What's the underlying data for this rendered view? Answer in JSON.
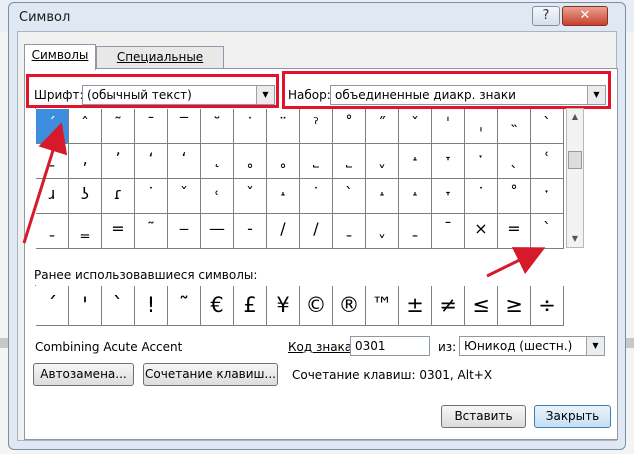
{
  "window": {
    "title": "Символ",
    "help_label": "?",
    "close_label": "✕"
  },
  "tabs": [
    {
      "label": "Символы"
    },
    {
      "label": "Специальные знаки"
    }
  ],
  "font": {
    "label": "Шрифт:",
    "value": "(обычный текст)"
  },
  "subset": {
    "label": "Набор:",
    "value": "объединенные диакр. знаки"
  },
  "symbol_grid": {
    "rows": [
      [
        "ˊ",
        "ˆ",
        "˜",
        "¯",
        "‾",
        "˘",
        "˙",
        "¨",
        "ˀ",
        "˚",
        "˝",
        "ˇ",
        "ˈ",
        "ˌ",
        "˵",
        "ˋ"
      ],
      [
        "ˍ",
        "‚",
        "ʼ",
        "‘",
        "ʻ",
        "˛",
        "˳",
        "˳",
        "˾",
        "˾",
        "ˬ",
        "˔",
        "˕",
        "ˑ",
        "ˎ",
        "ʿ"
      ],
      [
        "ɹ",
        "ʖ",
        "ɾ",
        "˙",
        "ˇ",
        "˓",
        "ˇ",
        "˔",
        "˙",
        "ˋ",
        "˔",
        "˔",
        "˕",
        "˙",
        "˚",
        "ˑ"
      ],
      [
        "ˍ",
        "‗",
        "=",
        "˜",
        "‒",
        "—",
        "‐",
        "/",
        "/",
        "ˍ",
        "ˬ",
        "ˍ",
        "ˉ",
        "×",
        "=",
        "ˋ"
      ]
    ]
  },
  "recent": {
    "label": "Ранее использовавшиеся символы:",
    "symbols": [
      "´",
      "'",
      "`",
      "!",
      "˜",
      "€",
      "£",
      "¥",
      "©",
      "®",
      "™",
      "±",
      "≠",
      "≤",
      "≥",
      "÷"
    ]
  },
  "char_name": "Combining Acute Accent",
  "code": {
    "label": "Код знака:",
    "value": "0301"
  },
  "from": {
    "label": "из:",
    "value": "Юникод (шестн.)"
  },
  "buttons": {
    "autocorrect": "Автозамена...",
    "shortcut_key": "Сочетание клавиш...",
    "insert": "Вставить",
    "close": "Закрыть"
  },
  "shortcut_text": "Сочетание клавиш: 0301, Alt+X",
  "colors": {
    "highlight_box": "#e3132a",
    "selected_cell": "#3e8ee0",
    "arrow": "#d61a2a"
  }
}
